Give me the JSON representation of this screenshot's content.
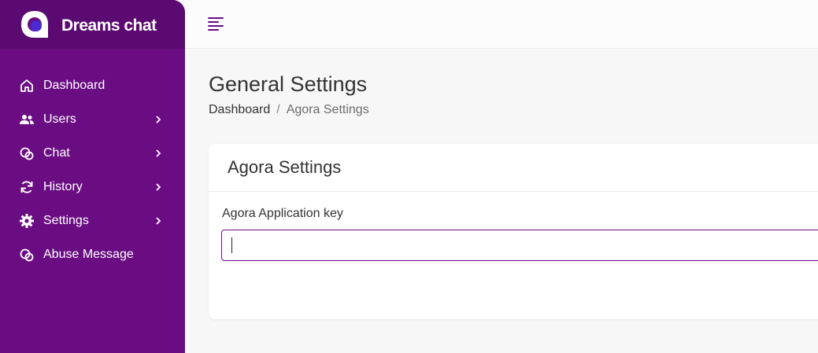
{
  "brand": {
    "name": "Dreams chat",
    "color": "#6a0d83"
  },
  "sidebar": {
    "items": [
      {
        "label": "Dashboard",
        "icon": "home-icon",
        "has_submenu": false
      },
      {
        "label": "Users",
        "icon": "users-icon",
        "has_submenu": true
      },
      {
        "label": "Chat",
        "icon": "chat-icon",
        "has_submenu": true
      },
      {
        "label": "History",
        "icon": "refresh-icon",
        "has_submenu": true
      },
      {
        "label": "Settings",
        "icon": "gear-icon",
        "has_submenu": true
      },
      {
        "label": "Abuse Message",
        "icon": "chat-icon",
        "has_submenu": false
      }
    ]
  },
  "topbar": {
    "menu_icon": "hamburger-icon"
  },
  "page": {
    "title": "General Settings",
    "breadcrumb": {
      "home": "Dashboard",
      "separator": "/",
      "current": "Agora Settings"
    }
  },
  "card": {
    "title": "Agora Settings",
    "field": {
      "label": "Agora Application key",
      "value": "",
      "placeholder": ""
    }
  }
}
